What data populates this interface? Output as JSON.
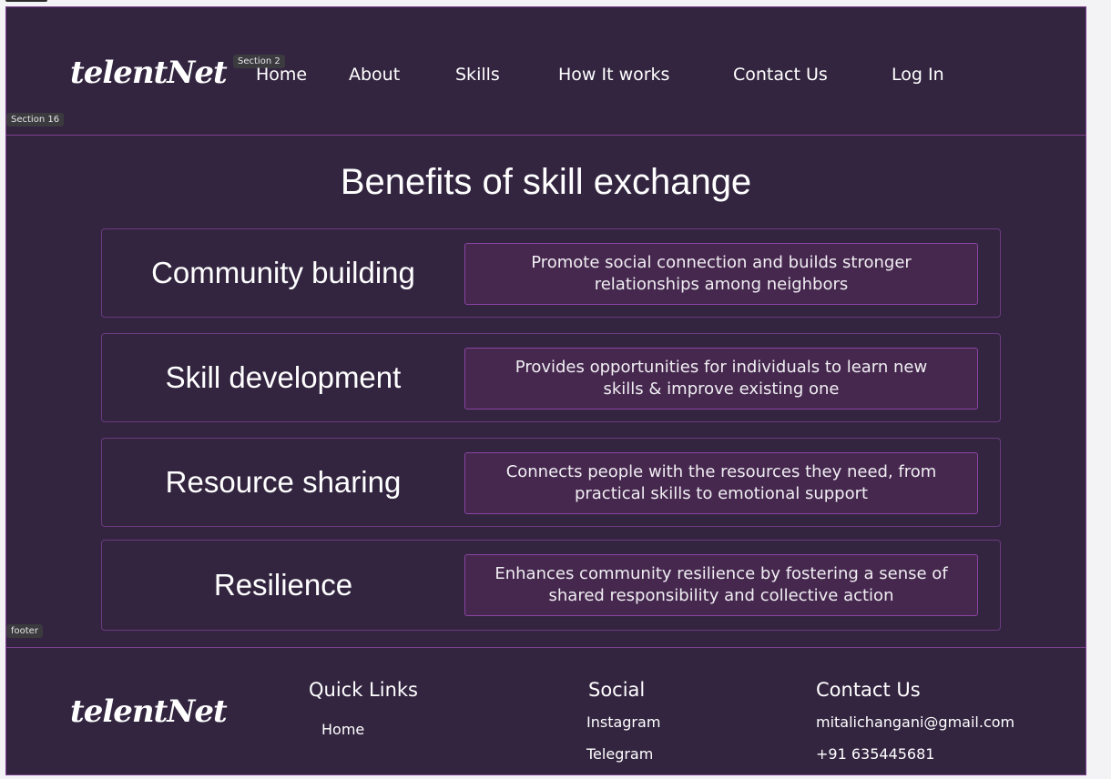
{
  "header": {
    "logo": "telentNet",
    "nav": [
      "Home",
      "About",
      "Skills",
      "How It works",
      "Contact Us"
    ],
    "login": "Log In"
  },
  "design_tags": {
    "section_2": "Section 2",
    "section_16": "Section 16",
    "footer": "footer"
  },
  "benefits": {
    "title": "Benefits of skill exchange",
    "items": [
      {
        "title": "Community building",
        "desc": "Promote social connection and builds stronger relationships among neighbors"
      },
      {
        "title": "Skill development",
        "desc": "Provides opportunities for individuals to learn new skills & improve existing one"
      },
      {
        "title": "Resource sharing",
        "desc": "Connects people with the resources they need, from practical skills to emotional support"
      },
      {
        "title": "Resilience",
        "desc": "Enhances community resilience by fostering a sense of shared responsibility and collective action"
      }
    ]
  },
  "footer": {
    "logo": "telentNet",
    "quick_links": {
      "heading": "Quick Links",
      "items": [
        "Home"
      ]
    },
    "social": {
      "heading": "Social",
      "items": [
        "Instagram",
        "Telegram"
      ]
    },
    "contact": {
      "heading": "Contact Us",
      "email": "mitalichangani@gmail.com",
      "phone": "+91 635445681"
    }
  },
  "colors": {
    "background": "#332540",
    "border": "#7c3f8f",
    "desc_box": "#46284f",
    "outer": "#f3f2f5"
  }
}
